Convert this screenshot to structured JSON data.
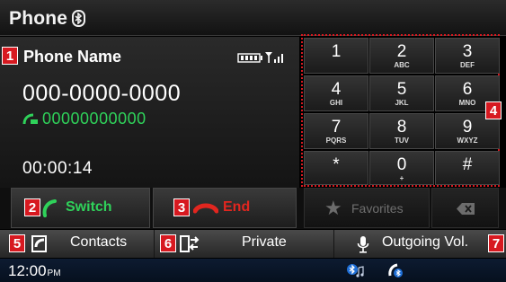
{
  "header": {
    "title": "Phone",
    "bluetooth_icon": "bluetooth-icon"
  },
  "call": {
    "phone_name": "Phone Name",
    "phone_number": "000-0000-0000",
    "secondary_number": "00000000000",
    "elapsed_time": "00:00:14"
  },
  "callouts": [
    "1",
    "2",
    "3",
    "4",
    "5",
    "6",
    "7"
  ],
  "actions": {
    "switch_label": "Switch",
    "end_label": "End",
    "favorites_label": "Favorites"
  },
  "keypad": {
    "keys": [
      {
        "digit": "1",
        "letters": ""
      },
      {
        "digit": "2",
        "letters": "ABC"
      },
      {
        "digit": "3",
        "letters": "DEF"
      },
      {
        "digit": "4",
        "letters": "GHI"
      },
      {
        "digit": "5",
        "letters": "JKL"
      },
      {
        "digit": "6",
        "letters": "MNO"
      },
      {
        "digit": "7",
        "letters": "PQRS"
      },
      {
        "digit": "8",
        "letters": "TUV"
      },
      {
        "digit": "9",
        "letters": "WXYZ"
      },
      {
        "digit": "*",
        "letters": ""
      },
      {
        "digit": "0",
        "letters": "+"
      },
      {
        "digit": "#",
        "letters": ""
      }
    ]
  },
  "bottom_bar": {
    "contacts_label": "Contacts",
    "private_label": "Private",
    "outgoing_label": "Outgoing Vol."
  },
  "status": {
    "time": "12:00",
    "ampm": "PM"
  },
  "colors": {
    "badge": "#d71920",
    "accent_green": "#2fd25a",
    "end_red": "#e2261f",
    "status_bar": "#0d1b31"
  }
}
